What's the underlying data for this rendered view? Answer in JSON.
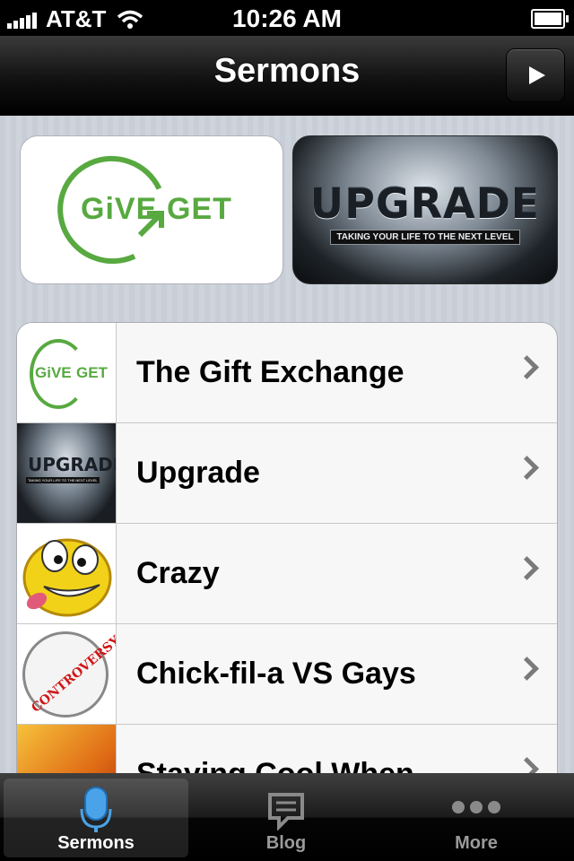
{
  "status_bar": {
    "carrier": "AT&T",
    "time": "10:26 AM"
  },
  "nav": {
    "title": "Sermons"
  },
  "featured": {
    "give_get": {
      "word1": "GiVE",
      "word2": "GET"
    },
    "upgrade": {
      "title": "UPGRADE",
      "subtitle": "TAKING YOUR LIFE TO THE NEXT LEVEL"
    }
  },
  "list": {
    "items": [
      {
        "label": "The Gift Exchange"
      },
      {
        "label": "Upgrade"
      },
      {
        "label": "Crazy"
      },
      {
        "label": "Chick-fil-a VS Gays"
      },
      {
        "label": "Staying Cool When"
      }
    ],
    "thumb_text": {
      "give1": "GiVE",
      "give2": "GET",
      "upgrade": "UPGRADE",
      "upgrade_sub": "TAKING YOUR LIFE TO THE NEXT LEVEL",
      "controversy": "CONTROVERSY"
    }
  },
  "tabs": [
    {
      "label": "Sermons",
      "icon": "microphone-icon"
    },
    {
      "label": "Blog",
      "icon": "speech-bubble-icon"
    },
    {
      "label": "More",
      "icon": "more-dots-icon"
    }
  ],
  "colors": {
    "accent_green": "#58a940",
    "tab_active_blue": "#4aa3e8"
  }
}
